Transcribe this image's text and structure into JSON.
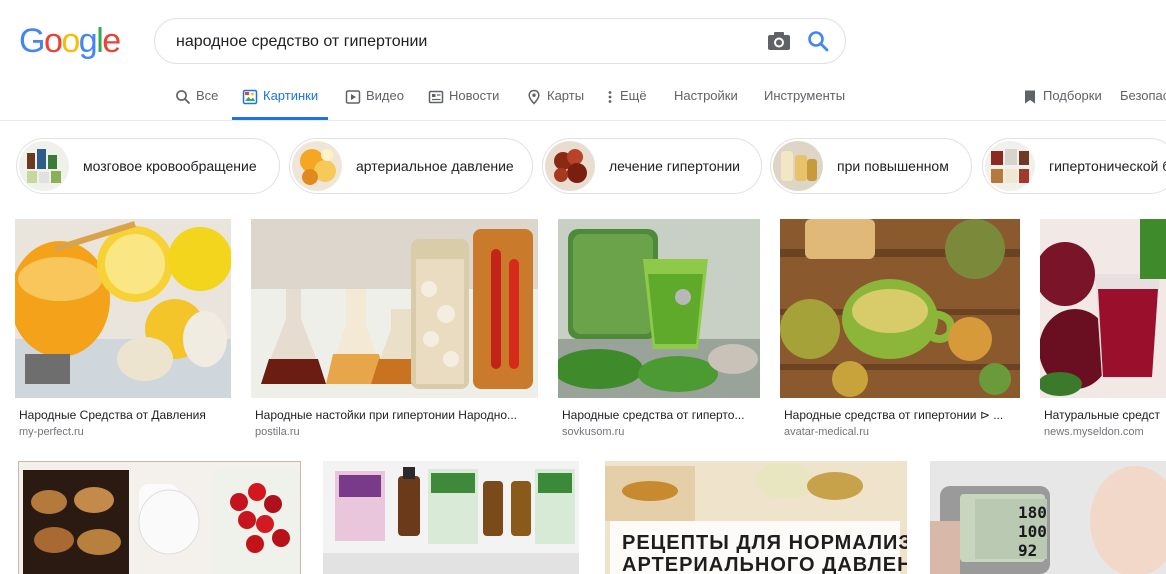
{
  "logo": {
    "letters": [
      "G",
      "o",
      "o",
      "g",
      "l",
      "e"
    ],
    "colors": [
      "#4285f4",
      "#ea4335",
      "#fbbc05",
      "#4285f4",
      "#34a853",
      "#ea4335"
    ]
  },
  "search": {
    "query": "народное средство от гипертонии",
    "camera_icon": "camera-icon",
    "search_icon": "search-icon"
  },
  "tabs": [
    {
      "label": "Все",
      "icon": "search-icon"
    },
    {
      "label": "Картинки",
      "icon": "image-icon",
      "active": true
    },
    {
      "label": "Видео",
      "icon": "play-icon"
    },
    {
      "label": "Новости",
      "icon": "newspaper-icon"
    },
    {
      "label": "Карты",
      "icon": "map-pin-icon"
    },
    {
      "label": "Ещё",
      "icon": "more-vertical-icon"
    },
    {
      "label": "Настройки"
    },
    {
      "label": "Инструменты"
    },
    {
      "label": "Подборки",
      "icon": "bookmark-icon"
    },
    {
      "label": "Безопас"
    }
  ],
  "chips": [
    {
      "label": "мозговое кровообращение"
    },
    {
      "label": "артериальное давление"
    },
    {
      "label": "лечение гипертонии"
    },
    {
      "label": "при повышенном"
    },
    {
      "label": "гипертонической б"
    }
  ],
  "results_row1": [
    {
      "title": "Народные Средства от Давления",
      "source": "my-perfect.ru"
    },
    {
      "title": "Народные настойки при гипертонии Народно...",
      "source": "postila.ru"
    },
    {
      "title": "Народные средства от гиперто...",
      "source": "sovkusom.ru"
    },
    {
      "title": "Народные средства от гипертонии ⊳ ...",
      "source": "avatar-medical.ru"
    },
    {
      "title": "Натуральные средст",
      "source": "news.myseldon.com"
    }
  ],
  "results_row2": [
    {
      "title": ""
    },
    {
      "title": ""
    },
    {
      "overlay_line1": "РЕЦЕПТЫ ДЛЯ НОРМАЛИЗАЦИИ",
      "overlay_line2": "АРТЕРИАЛЬНОГО ДАВЛЕНИЯ"
    },
    {
      "display_values": [
        "180",
        "100",
        "92"
      ]
    }
  ],
  "colors": {
    "accent": "#1a73e8",
    "text": "#202124",
    "muted": "#5f6368",
    "source": "#70757a"
  }
}
